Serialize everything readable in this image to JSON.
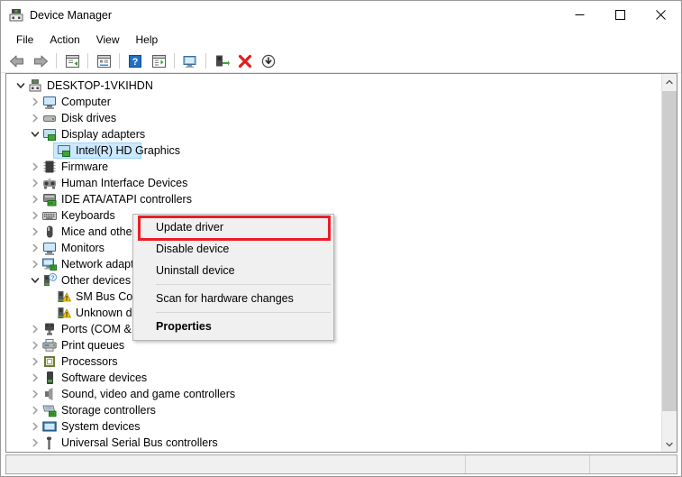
{
  "window": {
    "title": "Device Manager",
    "title_icon": "device-manager-icon",
    "controls": {
      "minimize": "minimize-icon",
      "maximize": "maximize-icon",
      "close": "close-icon"
    }
  },
  "menubar": {
    "items": [
      {
        "label": "File"
      },
      {
        "label": "Action"
      },
      {
        "label": "View"
      },
      {
        "label": "Help"
      }
    ]
  },
  "toolbar": {
    "buttons": [
      {
        "name": "back-icon"
      },
      {
        "name": "forward-icon"
      },
      {
        "name": "show-hide-console-tree-icon"
      },
      {
        "name": "properties-icon"
      },
      {
        "name": "help-icon"
      },
      {
        "name": "show-hide-action-pane-icon"
      },
      {
        "name": "update-driver-icon"
      },
      {
        "name": "uninstall-device-icon"
      },
      {
        "name": "disable-device-icon"
      },
      {
        "name": "scan-for-hardware-changes-icon"
      }
    ]
  },
  "tree": {
    "root": {
      "label": "DESKTOP-1VKIHDN",
      "icon": "computer-root-icon",
      "expanded": true
    },
    "items": [
      {
        "label": "Computer",
        "icon": "computer-icon",
        "indent": 1,
        "expander": "collapsed",
        "selected": false
      },
      {
        "label": "Disk drives",
        "icon": "disk-drive-icon",
        "indent": 1,
        "expander": "collapsed",
        "selected": false
      },
      {
        "label": "Display adapters",
        "icon": "display-adapter-icon",
        "indent": 1,
        "expander": "expanded",
        "selected": false
      },
      {
        "label": "Intel(R) HD Graphics",
        "icon": "display-adapter-icon",
        "indent": 2,
        "expander": "none",
        "selected": true
      },
      {
        "label": "Firmware",
        "icon": "firmware-icon",
        "indent": 1,
        "expander": "collapsed",
        "selected": false
      },
      {
        "label": "Human Interface Devices",
        "icon": "human-interface-device-icon",
        "indent": 1,
        "expander": "collapsed",
        "selected": false
      },
      {
        "label": "IDE ATA/ATAPI controllers",
        "icon": "ide-controller-icon",
        "indent": 1,
        "expander": "collapsed",
        "selected": false
      },
      {
        "label": "Keyboards",
        "icon": "keyboard-icon",
        "indent": 1,
        "expander": "collapsed",
        "selected": false
      },
      {
        "label": "Mice and other pointing devices",
        "icon": "mouse-icon",
        "indent": 1,
        "expander": "collapsed",
        "selected": false
      },
      {
        "label": "Monitors",
        "icon": "monitor-icon",
        "indent": 1,
        "expander": "collapsed",
        "selected": false
      },
      {
        "label": "Network adapters",
        "icon": "network-adapter-icon",
        "indent": 1,
        "expander": "collapsed",
        "selected": false
      },
      {
        "label": "Other devices",
        "icon": "other-device-icon",
        "indent": 1,
        "expander": "expanded",
        "selected": false
      },
      {
        "label": "SM Bus Controller",
        "icon": "unknown-device-warning-icon",
        "indent": 2,
        "expander": "none",
        "selected": false
      },
      {
        "label": "Unknown device",
        "icon": "unknown-device-warning-icon",
        "indent": 2,
        "expander": "none",
        "selected": false
      },
      {
        "label": "Ports (COM & LPT)",
        "icon": "port-icon",
        "indent": 1,
        "expander": "collapsed",
        "selected": false
      },
      {
        "label": "Print queues",
        "icon": "printer-icon",
        "indent": 1,
        "expander": "collapsed",
        "selected": false
      },
      {
        "label": "Processors",
        "icon": "processor-icon",
        "indent": 1,
        "expander": "collapsed",
        "selected": false
      },
      {
        "label": "Software devices",
        "icon": "software-device-icon",
        "indent": 1,
        "expander": "collapsed",
        "selected": false
      },
      {
        "label": "Sound, video and game controllers",
        "icon": "sound-controller-icon",
        "indent": 1,
        "expander": "collapsed",
        "selected": false
      },
      {
        "label": "Storage controllers",
        "icon": "storage-controller-icon",
        "indent": 1,
        "expander": "collapsed",
        "selected": false
      },
      {
        "label": "System devices",
        "icon": "system-device-icon",
        "indent": 1,
        "expander": "collapsed",
        "selected": false
      },
      {
        "label": "Universal Serial Bus controllers",
        "icon": "usb-controller-icon",
        "indent": 1,
        "expander": "collapsed",
        "selected": false
      }
    ]
  },
  "context_menu": {
    "items": [
      {
        "label": "Update driver",
        "bold": false,
        "highlighted": true
      },
      {
        "label": "Disable device",
        "bold": false,
        "highlighted": false
      },
      {
        "label": "Uninstall device",
        "bold": false,
        "highlighted": false
      },
      {
        "separator": true
      },
      {
        "label": "Scan for hardware changes",
        "bold": false,
        "highlighted": false
      },
      {
        "separator": true
      },
      {
        "label": "Properties",
        "bold": true,
        "highlighted": false
      }
    ]
  },
  "annotation": {
    "highlight_color": "#ee1c25",
    "target": "Update driver"
  },
  "statusbar": {
    "text": ""
  },
  "colors": {
    "selection": "#cce8ff",
    "window_bg": "#ffffff",
    "chrome_bg": "#f0f0f0",
    "accent_red": "#ee1c25",
    "accent_green": "#3fa535"
  }
}
